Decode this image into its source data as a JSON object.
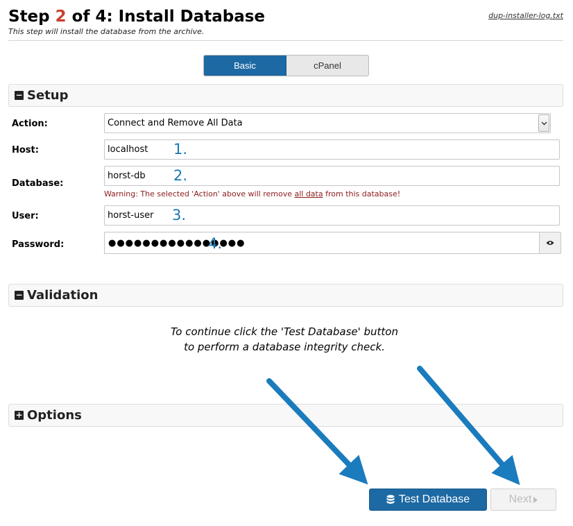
{
  "header": {
    "title_prefix": "Step ",
    "step_current": "2",
    "title_suffix": " of 4: Install Database",
    "subtitle": "This step will install the database from the archive.",
    "log_link": "dup-installer-log.txt"
  },
  "mode_toggle": {
    "basic": "Basic",
    "cpanel": "cPanel",
    "selected": "Basic"
  },
  "setup": {
    "title": "Setup",
    "action_label": "Action:",
    "action_value": "Connect and Remove All Data",
    "host_label": "Host:",
    "host_value": "localhost",
    "database_label": "Database:",
    "database_value": "horst-db",
    "warning_prefix": "Warning: The selected 'Action' above will remove ",
    "warning_link": "all data",
    "warning_suffix": " from this database!",
    "user_label": "User:",
    "user_value": "horst-user",
    "password_label": "Password:",
    "password_value": "●●●●●●●●●●●●●●●●"
  },
  "annotations": {
    "n1": "1.",
    "n2": "2.",
    "n3": "3.",
    "n4": "4."
  },
  "validation": {
    "title": "Validation",
    "line1": "To continue click the 'Test Database' button",
    "line2": "to perform a database integrity check."
  },
  "options": {
    "title": "Options"
  },
  "buttons": {
    "test_database": "Test Database",
    "next": "Next"
  },
  "colors": {
    "accent": "#1d69a3",
    "step_highlight": "#c9402f",
    "annotation": "#1977b7",
    "warning": "#8b1a1a"
  },
  "icons": {
    "collapse": "minus-square-icon",
    "expand": "plus-square-icon",
    "eye": "eye-icon",
    "database": "database-icon",
    "next": "caret-right-icon"
  }
}
